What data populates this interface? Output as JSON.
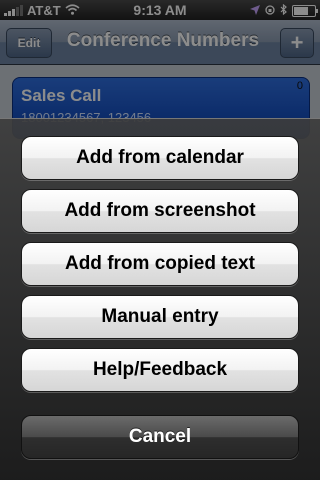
{
  "status_bar": {
    "carrier": "AT&T",
    "time": "9:13 AM",
    "battery_level": 0.8
  },
  "nav_bar": {
    "edit_label": "Edit",
    "title": "Conference Numbers",
    "add_label": "+"
  },
  "content": {
    "card": {
      "title": "Sales Call",
      "number": "18001234567, 123456",
      "count": "0"
    }
  },
  "action_sheet": {
    "buttons": [
      {
        "label": "Add from calendar"
      },
      {
        "label": "Add from screenshot"
      },
      {
        "label": "Add from copied text"
      },
      {
        "label": "Manual entry"
      },
      {
        "label": "Help/Feedback"
      }
    ],
    "cancel_label": "Cancel"
  },
  "icons": {
    "signal": "signal-bars-icon",
    "wifi": "wifi-icon",
    "location": "location-arrow-icon",
    "lock": "orientation-lock-icon",
    "bluetooth": "bluetooth-icon",
    "battery": "battery-icon"
  },
  "colors": {
    "nav_bar": "#6d84a2",
    "card": "#0a3fb0",
    "sheet_button": "#e2e2e2",
    "cancel_button": "#2e2e2e"
  }
}
